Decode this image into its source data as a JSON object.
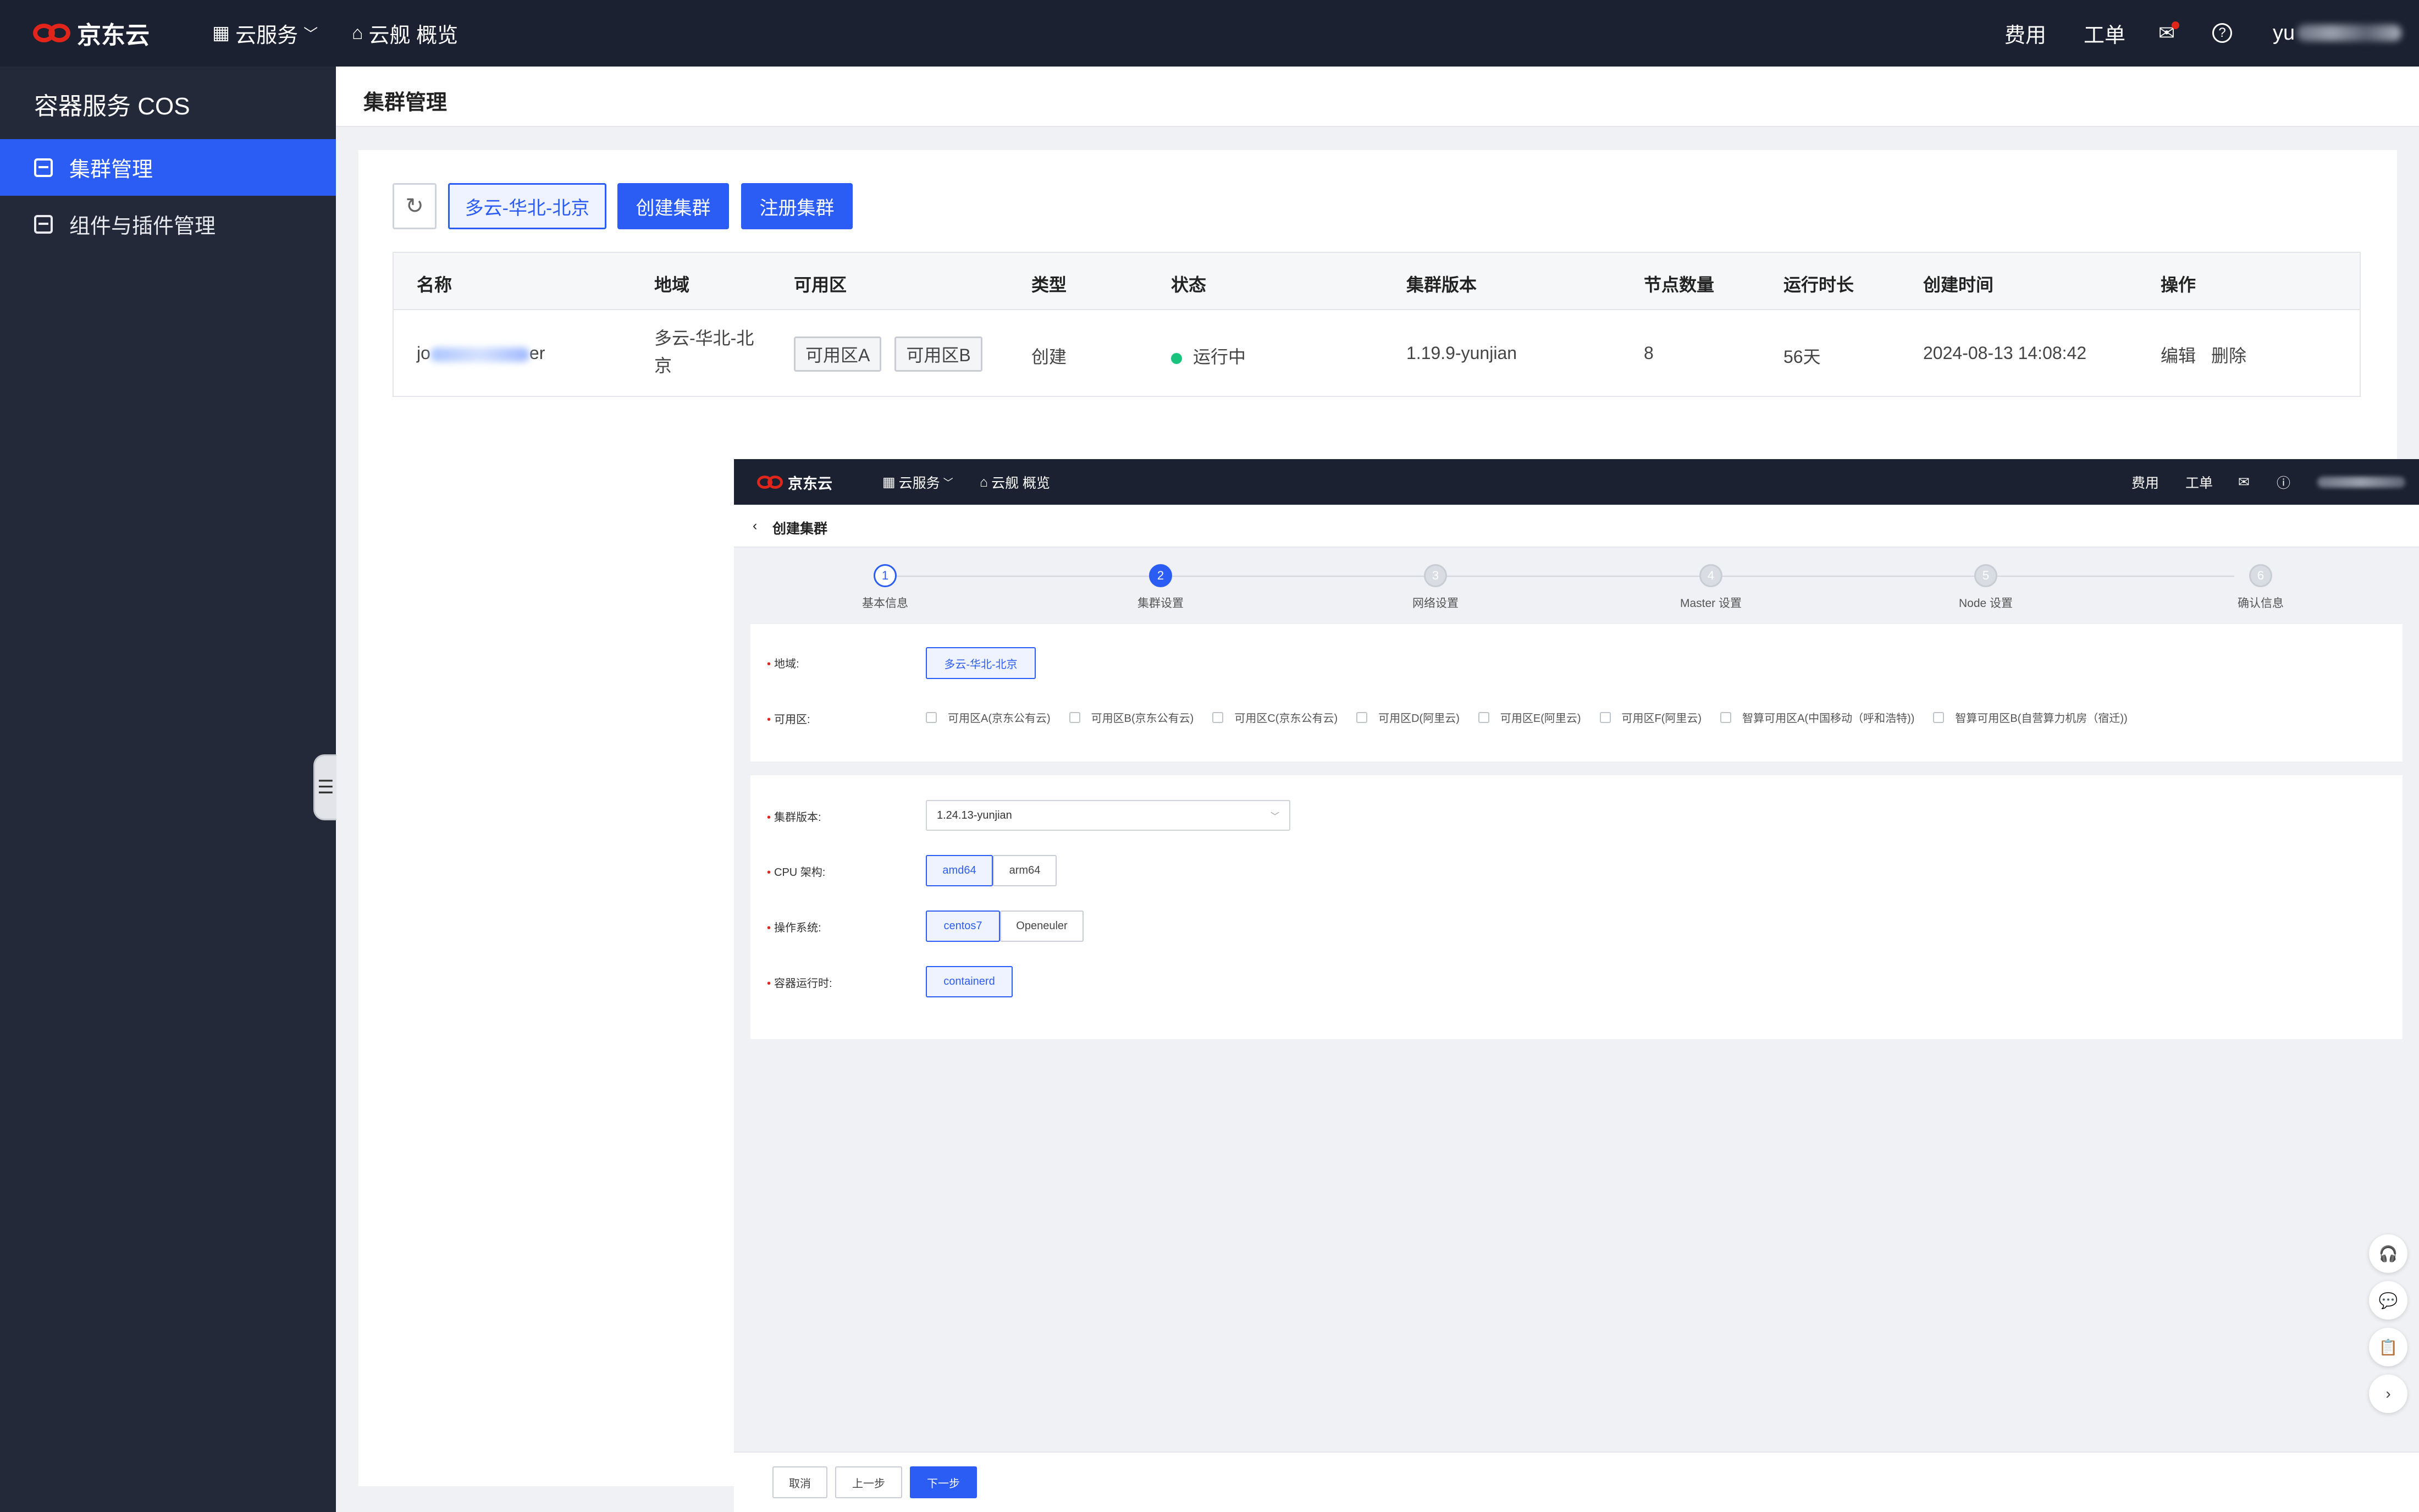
{
  "topbar": {
    "brand": "京东云",
    "nav": [
      {
        "icon": "grid-icon",
        "label": "云服务"
      },
      {
        "icon": "home-icon",
        "label": "云舰 概览"
      }
    ],
    "right": {
      "fee": "费用",
      "ticket": "工单",
      "user": "yu"
    }
  },
  "sidebar": {
    "title": "容器服务 COS",
    "items": [
      {
        "label": "集群管理",
        "active": true
      },
      {
        "label": "组件与插件管理",
        "active": false
      }
    ]
  },
  "page": {
    "title": "集群管理",
    "toolbar": {
      "region": "多云-华北-北京",
      "create": "创建集群",
      "register": "注册集群"
    }
  },
  "table": {
    "headers": [
      "名称",
      "地域",
      "可用区",
      "类型",
      "状态",
      "集群版本",
      "节点数量",
      "运行时长",
      "创建时间",
      "操作"
    ],
    "rows": [
      {
        "name_start": "jo",
        "name_end": "er",
        "region_l1": "多云-华北-北",
        "region_l2": "京",
        "zones": [
          "可用区A",
          "可用区B"
        ],
        "type": "创建",
        "status": "运行中",
        "version": "1.19.9-yunjian",
        "nodes": "8",
        "uptime": "56天",
        "created": "2024-08-13 14:08:42",
        "actions": [
          "编辑",
          "删除"
        ]
      }
    ]
  },
  "overlay": {
    "topbar": {
      "brand": "京东云",
      "nav": [
        "云服务",
        "云舰 概览"
      ],
      "fee": "费用",
      "ticket": "工单"
    },
    "title": "创建集群",
    "steps": [
      {
        "num": "1",
        "label": "基本信息",
        "state": "done"
      },
      {
        "num": "2",
        "label": "集群设置",
        "state": "current"
      },
      {
        "num": "3",
        "label": "网络设置",
        "state": "todo"
      },
      {
        "num": "4",
        "label": "Master 设置",
        "state": "todo"
      },
      {
        "num": "5",
        "label": "Node 设置",
        "state": "todo"
      },
      {
        "num": "6",
        "label": "确认信息",
        "state": "todo"
      }
    ],
    "form": {
      "region_label": "地域:",
      "region_value": "多云-华北-北京",
      "zone_label": "可用区:",
      "zones": [
        "可用区A(京东公有云)",
        "可用区B(京东公有云)",
        "可用区C(京东公有云)",
        "可用区D(阿里云)",
        "可用区E(阿里云)",
        "可用区F(阿里云)",
        "智算可用区A(中国移动（呼和浩特))",
        "智算可用区B(自营算力机房（宿迁))"
      ],
      "version_label": "集群版本:",
      "version_value": "1.24.13-yunjian",
      "cpu_label": "CPU 架构:",
      "cpu_options": [
        "amd64",
        "arm64"
      ],
      "os_label": "操作系统:",
      "os_options": [
        "centos7",
        "Openeuler"
      ],
      "runtime_label": "容器运行时:",
      "runtime_options": [
        "containerd"
      ]
    },
    "footer": {
      "cancel": "取消",
      "prev": "上一步",
      "next": "下一步"
    }
  }
}
